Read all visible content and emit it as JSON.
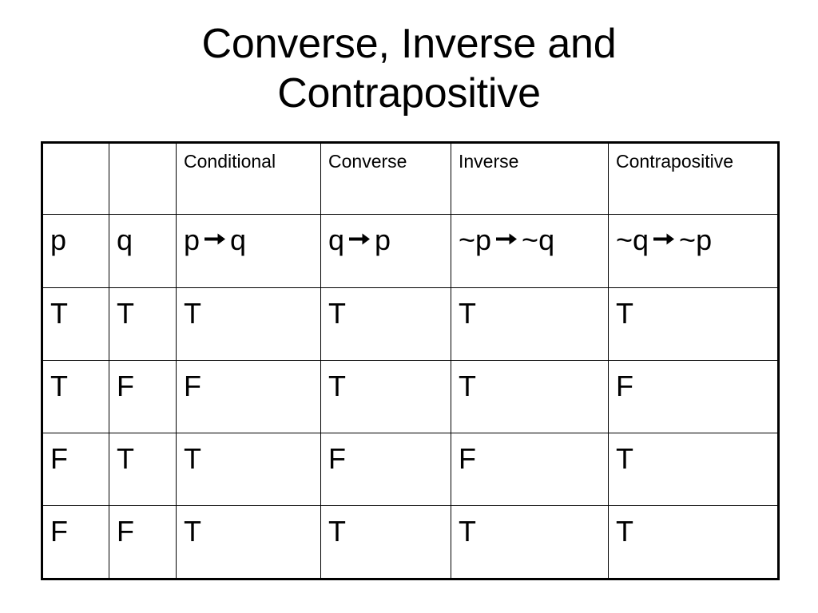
{
  "slide": {
    "title": "Converse, Inverse and\nContrapositive",
    "background_color": "#ffffff",
    "text_color": "#000000",
    "border_color": "#000000"
  },
  "table": {
    "header": {
      "blank_1": "",
      "blank_2": "",
      "conditional": "Conditional",
      "converse": "Converse",
      "inverse": "Inverse",
      "contrapositive": "Contrapositive"
    },
    "formulas": {
      "p": "p",
      "q": "q",
      "conditional_pre": "p",
      "conditional_post": "q",
      "converse_pre": "q",
      "converse_post": "p",
      "inverse_pre": "~p",
      "inverse_post": "~q",
      "contrapositive_pre": "~q",
      "contrapositive_post": "~p",
      "arrow_icon": "right-arrow-icon"
    },
    "rows": [
      {
        "p": "T",
        "q": "T",
        "conditional": "T",
        "converse": "T",
        "inverse": "T",
        "contrapositive": "T"
      },
      {
        "p": "T",
        "q": "F",
        "conditional": "F",
        "converse": "T",
        "inverse": "T",
        "contrapositive": "F"
      },
      {
        "p": "F",
        "q": "T",
        "conditional": "T",
        "converse": "F",
        "inverse": "F",
        "contrapositive": "T"
      },
      {
        "p": "F",
        "q": "F",
        "conditional": "T",
        "converse": "T",
        "inverse": "T",
        "contrapositive": "T"
      }
    ]
  }
}
